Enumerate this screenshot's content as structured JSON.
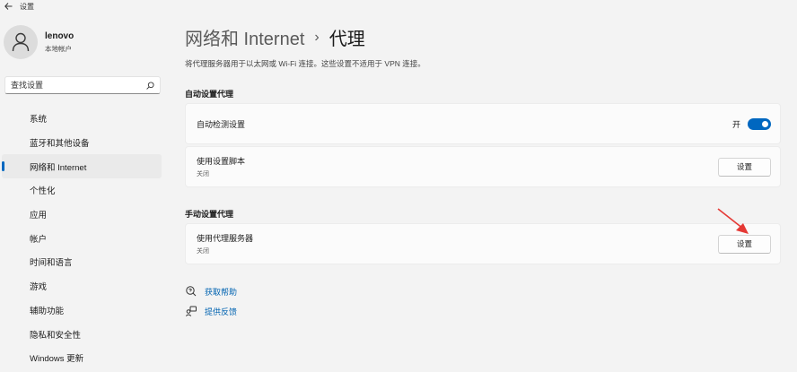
{
  "window": {
    "title": "设置"
  },
  "profile": {
    "name": "lenovo",
    "account_type": "本地帐户"
  },
  "search": {
    "placeholder": "查找设置"
  },
  "sidebar": {
    "items": [
      {
        "label": "系统"
      },
      {
        "label": "蓝牙和其他设备"
      },
      {
        "label": "网络和 Internet",
        "active": true
      },
      {
        "label": "个性化"
      },
      {
        "label": "应用"
      },
      {
        "label": "帐户"
      },
      {
        "label": "时间和语言"
      },
      {
        "label": "游戏"
      },
      {
        "label": "辅助功能"
      },
      {
        "label": "隐私和安全性"
      },
      {
        "label": "Windows 更新"
      }
    ]
  },
  "breadcrumb": {
    "parent": "网络和 Internet",
    "separator": "›",
    "current": "代理"
  },
  "description": "将代理服务器用于以太网或 Wi-Fi 连接。这些设置不适用于 VPN 连接。",
  "auto_section": {
    "title": "自动设置代理",
    "detect": {
      "label": "自动检测设置",
      "toggle_label": "开",
      "enabled": true
    },
    "script": {
      "label": "使用设置脚本",
      "status": "关闭",
      "button": "设置"
    }
  },
  "manual_section": {
    "title": "手动设置代理",
    "proxy": {
      "label": "使用代理服务器",
      "status": "关闭",
      "button": "设置"
    }
  },
  "links": {
    "help": "获取帮助",
    "feedback": "提供反馈"
  },
  "colors": {
    "accent": "#0067c0",
    "annotation_arrow": "#e53935"
  }
}
